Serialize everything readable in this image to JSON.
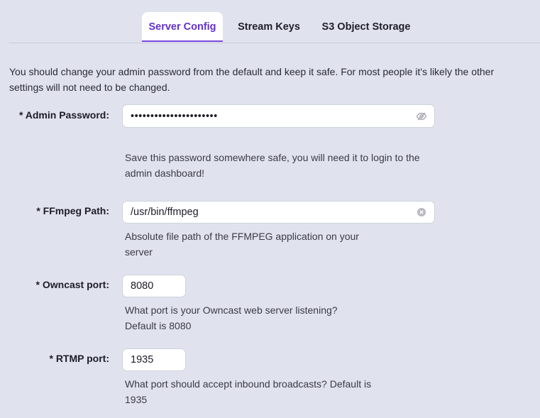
{
  "tabs": [
    {
      "label": "Server Config",
      "active": true
    },
    {
      "label": "Stream Keys",
      "active": false
    },
    {
      "label": "S3 Object Storage",
      "active": false
    }
  ],
  "intro": "You should change your admin password from the default and keep it safe. For most people it's likely the other settings will not need to be changed.",
  "fields": {
    "admin_password": {
      "label": "* Admin Password:",
      "value": "••••••••••••••••••••••",
      "help": "Save this password somewhere safe, you will need it to login to the admin dashboard!",
      "icon": "eye-slash-icon"
    },
    "ffmpeg_path": {
      "label": "* FFmpeg Path:",
      "value": "/usr/bin/ffmpeg",
      "help": "Absolute file path of the FFMPEG application on your server",
      "icon": "clear-icon"
    },
    "owncast_port": {
      "label": "* Owncast port:",
      "value": "8080",
      "help": "What port is your Owncast web server listening? Default is 8080"
    },
    "rtmp_port": {
      "label": "* RTMP port:",
      "value": "1935",
      "help": "What port should accept inbound broadcasts? Default is 1935"
    }
  },
  "colors": {
    "background": "#e0e3ee",
    "accent": "#6331cc",
    "input_bg": "#ffffff"
  }
}
